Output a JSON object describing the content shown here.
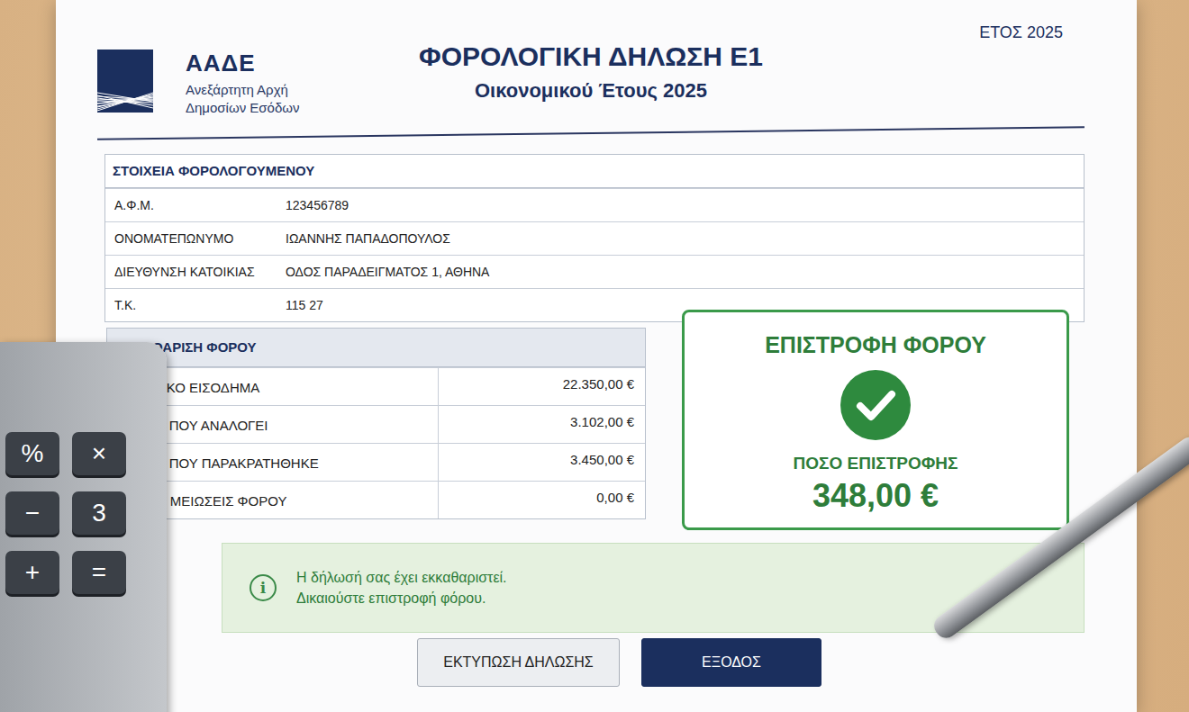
{
  "header": {
    "logo_title": "ΑΑΔΕ",
    "logo_subtitle": [
      "Ανεξάρτητη Αρχή",
      "Δημοσίων Εσόδων"
    ],
    "title": "ΦΟΡΟΛΟΓΙΚΗ ΔΗΛΩΣΗ Ε1",
    "subtitle": "Οικονομικού Έτους 2025",
    "year": "ΕΤΟΣ 2025"
  },
  "taxpayer": {
    "heading": "ΣΤΟΙΧΕΙΑ ΦΟΡΟΛΟΓΟΥΜΕΝΟΥ",
    "rows": [
      [
        "Α.Φ.Μ.",
        "123456789"
      ],
      [
        "ΟΝΟΜΑΤΕΠΩΝΥΜΟ",
        "ΙΩΑΝΝΗΣ ΠΑΠΑΔΟΠΟΥΛΟΣ"
      ],
      [
        "ΔΙΕΥΘΥΝΣΗ ΚΑΤΟΙΚΙΑΣ",
        "ΟΔΟΣ ΠΑΡΑΔΕΙΓΜΑΤΟΣ 1, ΑΘΗΝΑ"
      ],
      [
        "Τ.Κ.",
        "115 27"
      ]
    ]
  },
  "settlement": {
    "heading": "ΕΚΚΑΘΑΡΙΣΗ ΦΟΡΟΥ",
    "rows": [
      [
        "ΣΥΝΟΛΙΚΟ ΕΙΣΟΔΗΜΑ",
        "22.350,00 €"
      ],
      [
        "ΦΟΡΟΣ ΠΟΥ ΑΝΑΛΟΓΕΙ",
        "3.102,00 €"
      ],
      [
        "ΦΟΡΟΣ ΠΟΥ ΠΑΡΑΚΡΑΤΗΘΗΚΕ",
        "3.450,00 €"
      ],
      [
        "ΛΟΙΠΕΣ ΜΕΙΩΣΕΙΣ ΦΟΡΟΥ",
        "0,00 €"
      ]
    ]
  },
  "refund": {
    "title": "ΕΠΙΣΤΡΟΦΗ ΦΟΡΟΥ",
    "label": "ΠΟΣΟ ΕΠΙΣΤΡΟΦΗΣ",
    "amount": "348,00 €"
  },
  "notice": {
    "icon": "i",
    "lines": [
      "Η δήλωσή σας έχει εκκαθαριστεί.",
      "Δικαιούστε επιστροφή φόρου."
    ]
  },
  "buttons": [
    {
      "label": "ΕΚΤΥΠΩΣΗ ΔΗΛΩΣΗΣ",
      "kind": "secondary"
    },
    {
      "label": "ΕΞΟΔΟΣ",
      "kind": "primary"
    }
  ],
  "calculator": {
    "keys": [
      "%",
      "×",
      "−",
      "3",
      "+",
      "="
    ]
  }
}
